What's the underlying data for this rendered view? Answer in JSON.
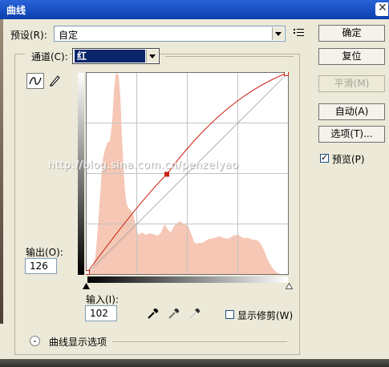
{
  "window": {
    "title": "曲线"
  },
  "preset": {
    "label": "预设(R):",
    "value": "自定"
  },
  "buttons": {
    "ok": "确定",
    "reset": "复位",
    "smooth": "平滑(M)",
    "auto": "自动(A)",
    "options": "选项(T)..."
  },
  "preview": {
    "label": "预览(P)",
    "checked": true
  },
  "channel": {
    "label": "通道(C):",
    "value": "红"
  },
  "output": {
    "label": "输出(O):",
    "value": "126"
  },
  "input": {
    "label": "输入(I):",
    "value": "102"
  },
  "show_clipping": {
    "label": "显示修剪(W)",
    "checked": false
  },
  "curve_options": {
    "label": "曲线显示选项"
  },
  "watermark": "http://blog.sina.com.cn/penzelyao",
  "curve": {
    "input": 102,
    "output": 126,
    "range": [
      0,
      255
    ]
  },
  "colors": {
    "histogram": "#f6c7b5",
    "curve": "#cc2211",
    "accent": "#0a246a"
  }
}
